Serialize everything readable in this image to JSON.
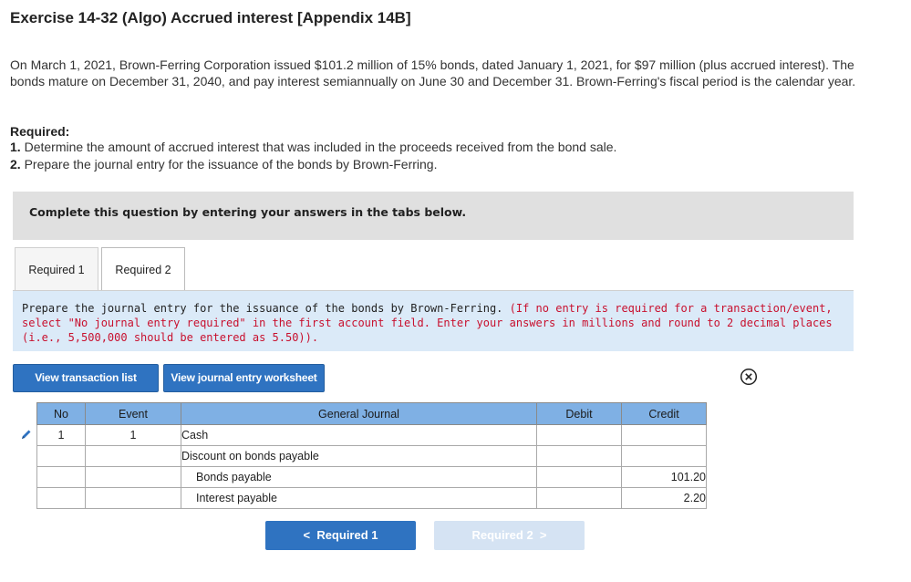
{
  "title": "Exercise 14-32 (Algo) Accrued interest [Appendix 14B]",
  "problem_text": "On March 1, 2021, Brown-Ferring Corporation issued $101.2 million of 15% bonds, dated January 1, 2021, for $97 million (plus accrued interest). The bonds mature on December 31, 2040, and pay interest semiannually on June 30 and December 31. Brown-Ferring's fiscal period is the calendar year.",
  "required": {
    "heading": "Required:",
    "items": [
      {
        "num": "1.",
        "text": "Determine the amount of accrued interest that was included in the proceeds received from the bond sale."
      },
      {
        "num": "2.",
        "text": "Prepare the journal entry for the issuance of the bonds by Brown-Ferring."
      }
    ]
  },
  "banner": "Complete this question by entering your answers in the tabs below.",
  "tabs": [
    {
      "label": "Required 1",
      "active": false
    },
    {
      "label": "Required 2",
      "active": true
    }
  ],
  "instructions": {
    "main": "Prepare the journal entry for the issuance of the bonds by Brown-Ferring.",
    "note": "(If no entry is required for a transaction/event, select \"No journal entry required\" in the first account field. Enter your answers in millions and round to 2 decimal places (i.e., 5,500,000 should be entered as 5.50))."
  },
  "buttons": {
    "transaction_list": "View transaction list",
    "journal_worksheet": "View journal entry worksheet"
  },
  "journal": {
    "headers": {
      "no": "No",
      "event": "Event",
      "general_journal": "General Journal",
      "debit": "Debit",
      "credit": "Credit"
    },
    "rows": [
      {
        "no": "1",
        "event": "1",
        "account": "Cash",
        "indent": false,
        "debit": "",
        "credit": ""
      },
      {
        "no": "",
        "event": "",
        "account": "Discount on bonds payable",
        "indent": false,
        "debit": "",
        "credit": ""
      },
      {
        "no": "",
        "event": "",
        "account": "Bonds payable",
        "indent": true,
        "debit": "",
        "credit": "101.20"
      },
      {
        "no": "",
        "event": "",
        "account": "Interest payable",
        "indent": true,
        "debit": "",
        "credit": "2.20"
      }
    ]
  },
  "nav": {
    "prev": "Required 1",
    "next": "Required 2",
    "prev_arrow": "<",
    "next_arrow": ">"
  },
  "colors": {
    "accent": "#2f73c1",
    "table_header": "#7fb0e4",
    "instruction_bg": "#dbeaf8",
    "note_red": "#c8102e"
  }
}
